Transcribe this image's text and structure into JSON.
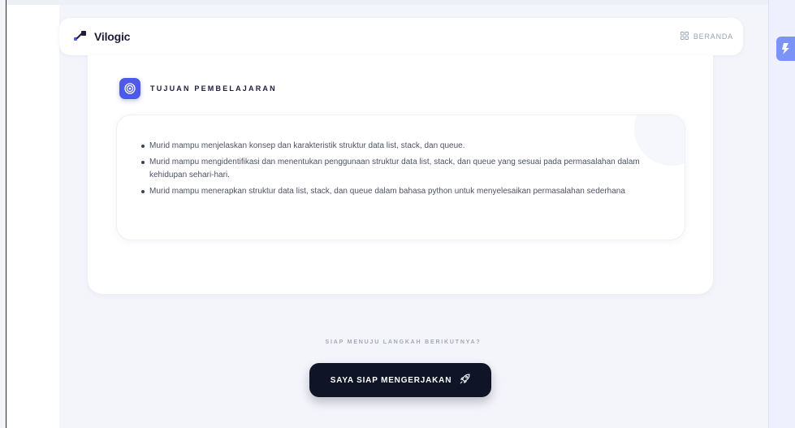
{
  "brand": {
    "name": "Vilogic"
  },
  "nav": {
    "home_label": "BERANDA",
    "home_icon": "grid-icon"
  },
  "section": {
    "title": "TUJUAN PEMBELAJARAN",
    "icon": "target-icon",
    "accent": "#4d5ae8"
  },
  "objectives": [
    "Murid mampu menjelaskan konsep dan karakteristik struktur data list, stack, dan queue.",
    "Murid mampu mengidentifikasi dan menentukan penggunaan struktur data list, stack, dan queue yang sesuai pada permasalahan dalam kehidupan sehari-hari.",
    "Murid mampu menerapkan struktur data list, stack, dan queue dalam bahasa python untuk menyelesaikan permasalahan sederhana"
  ],
  "cta": {
    "prompt": "SIAP MENUJU LANGKAH BERIKUTNYA?",
    "button_label": "SAYA SIAP MENGERJAKAN",
    "button_icon": "rocket-icon"
  },
  "colors": {
    "button_bg": "#0f1426",
    "widget": "#7b93f6"
  }
}
